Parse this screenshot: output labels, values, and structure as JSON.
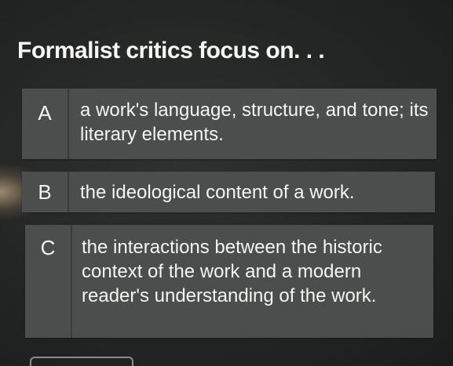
{
  "question": {
    "text": "Formalist critics focus on. . ."
  },
  "answers": [
    {
      "letter": "A",
      "text": "a work's language, structure, and tone; its literary elements."
    },
    {
      "letter": "B",
      "text": "the ideological content of a work."
    },
    {
      "letter": "C",
      "text": "the interactions between the historic context of the work and a modern reader's understanding of the work."
    }
  ],
  "colors": {
    "background": "#262827",
    "answer_box": "#4b4e4c",
    "text": "#f4f4f2"
  }
}
